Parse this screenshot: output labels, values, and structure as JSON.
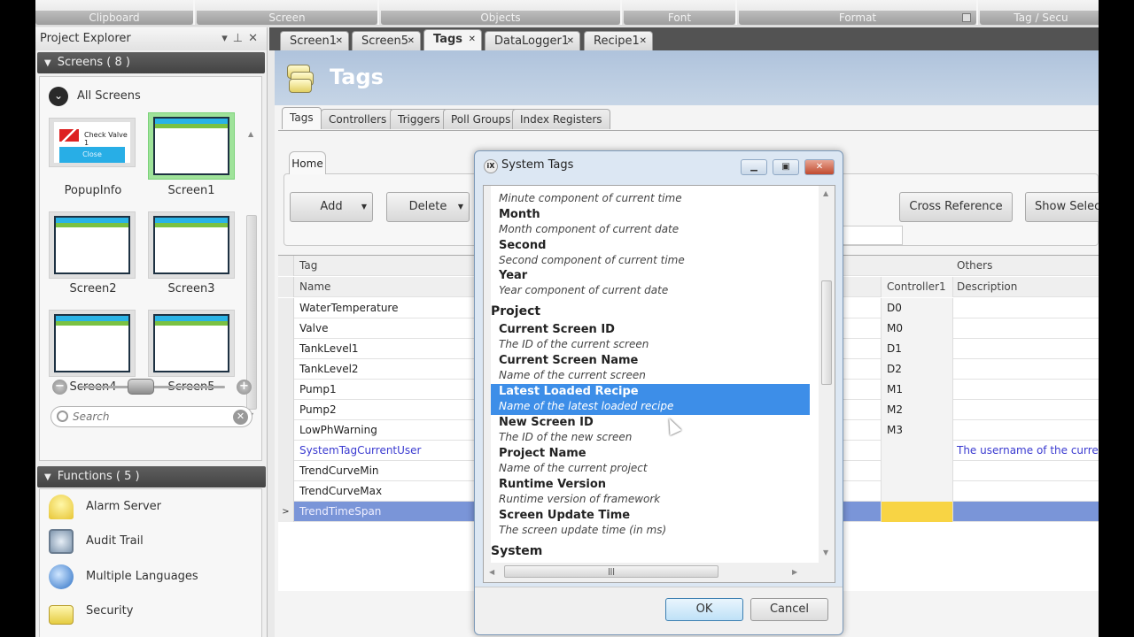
{
  "ribbon": {
    "groups": [
      {
        "label": "Clipboard"
      },
      {
        "label": "Screen"
      },
      {
        "label": "Objects"
      },
      {
        "label": "Font"
      },
      {
        "label": "Format"
      },
      {
        "label": "Tag / Secu"
      }
    ]
  },
  "project_explorer": {
    "title": "Project Explorer",
    "screens_header": "Screens ( 8 )",
    "all_screens_label": "All Screens",
    "screens": [
      {
        "name": "PopupInfo",
        "popup_title": "Check Valve 1",
        "popup_button": "Close"
      },
      {
        "name": "Screen1",
        "selected": true
      },
      {
        "name": "Screen2"
      },
      {
        "name": "Screen3"
      },
      {
        "name": "Screen4"
      },
      {
        "name": "Screen5"
      }
    ],
    "search_placeholder": "Search",
    "functions_header": "Functions ( 5 )",
    "functions": [
      {
        "label": "Alarm Server",
        "icon": "bell-icon"
      },
      {
        "label": "Audit Trail",
        "icon": "audit-trail-icon"
      },
      {
        "label": "Multiple Languages",
        "icon": "globe-icon"
      },
      {
        "label": "Security",
        "icon": "lock-icon"
      }
    ]
  },
  "doc_tabs": [
    {
      "label": "Screen1"
    },
    {
      "label": "Screen5"
    },
    {
      "label": "Tags",
      "active": true
    },
    {
      "label": "DataLogger1"
    },
    {
      "label": "Recipe1"
    }
  ],
  "tags_page": {
    "title": "Tags",
    "subtabs": [
      "Tags",
      "Controllers",
      "Triggers",
      "Poll Groups",
      "Index Registers"
    ],
    "home_tab": "Home",
    "buttons": {
      "add": "Add",
      "delete": "Delete",
      "cross_reference": "Cross Reference",
      "show_selection": "Show Selecti"
    },
    "grid": {
      "group_headers": {
        "tag": "Tag",
        "others": "Others"
      },
      "columns": {
        "name": "Name",
        "controller": "Controller1",
        "description": "Description"
      },
      "rows": [
        {
          "name": "WaterTemperature",
          "controller": "D0",
          "description": ""
        },
        {
          "name": "Valve",
          "controller": "M0",
          "description": ""
        },
        {
          "name": "TankLevel1",
          "controller": "D1",
          "description": ""
        },
        {
          "name": "TankLevel2",
          "controller": "D2",
          "description": ""
        },
        {
          "name": "Pump1",
          "controller": "M1",
          "description": ""
        },
        {
          "name": "Pump2",
          "controller": "M2",
          "description": ""
        },
        {
          "name": "LowPhWarning",
          "controller": "M3",
          "description": ""
        },
        {
          "name": "SystemTagCurrentUser",
          "controller": "",
          "description": "The username of the currently"
        },
        {
          "name": "TrendCurveMin",
          "controller": "",
          "description": ""
        },
        {
          "name": "TrendCurveMax",
          "controller": "",
          "description": ""
        },
        {
          "name": "TrendTimeSpan",
          "controller": "",
          "description": "",
          "selected": true,
          "row_marker": ">"
        }
      ]
    }
  },
  "dialog": {
    "title": "System Tags",
    "title_icon": "iX",
    "partial_top_item": "Minute",
    "items": [
      {
        "name": "",
        "desc": "Minute component of current time"
      },
      {
        "name": "Month",
        "desc": "Month component of current date"
      },
      {
        "name": "Second",
        "desc": "Second component of current time"
      },
      {
        "name": "Year",
        "desc": "Year component of current date"
      }
    ],
    "group_project": "Project",
    "project_items": [
      {
        "name": "Current Screen ID",
        "desc": "The ID of the current screen"
      },
      {
        "name": "Current Screen Name",
        "desc": "Name of the current screen"
      },
      {
        "name": "Latest Loaded Recipe",
        "desc": "Name of the latest loaded recipe",
        "selected": true
      },
      {
        "name": "New Screen ID",
        "desc": "The ID of the new screen"
      },
      {
        "name": "Project Name",
        "desc": "Name of the current project"
      },
      {
        "name": "Runtime Version",
        "desc": "Runtime version of framework"
      },
      {
        "name": "Screen Update Time",
        "desc": "The screen update time (in ms)"
      }
    ],
    "group_system": "System",
    "ok_label": "OK",
    "cancel_label": "Cancel"
  },
  "colors": {
    "selection_blue": "#3d8ee8",
    "grid_selection": "#7a95d8",
    "highlight_yellow": "#f8d444",
    "link_blue": "#3a3ad0"
  }
}
